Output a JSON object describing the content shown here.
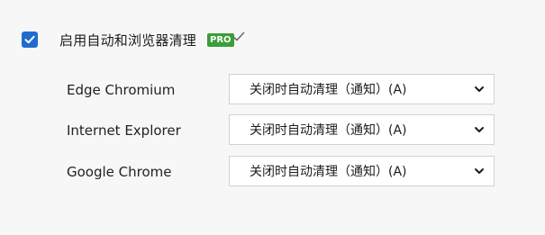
{
  "auto_clean": {
    "checked": true,
    "label": "启用自动和浏览器清理",
    "badge": "PRO"
  },
  "browsers": [
    {
      "name": "Edge Chromium",
      "selected_option": "关闭时自动清理（通知）(A)"
    },
    {
      "name": "Internet Explorer",
      "selected_option": "关闭时自动清理（通知）(A)"
    },
    {
      "name": "Google Chrome",
      "selected_option": "关闭时自动清理（通知）(A)"
    }
  ],
  "colors": {
    "checkbox": "#1f6ccf",
    "pro_badge": "#3a9e3a",
    "background": "#f7f7f7"
  }
}
